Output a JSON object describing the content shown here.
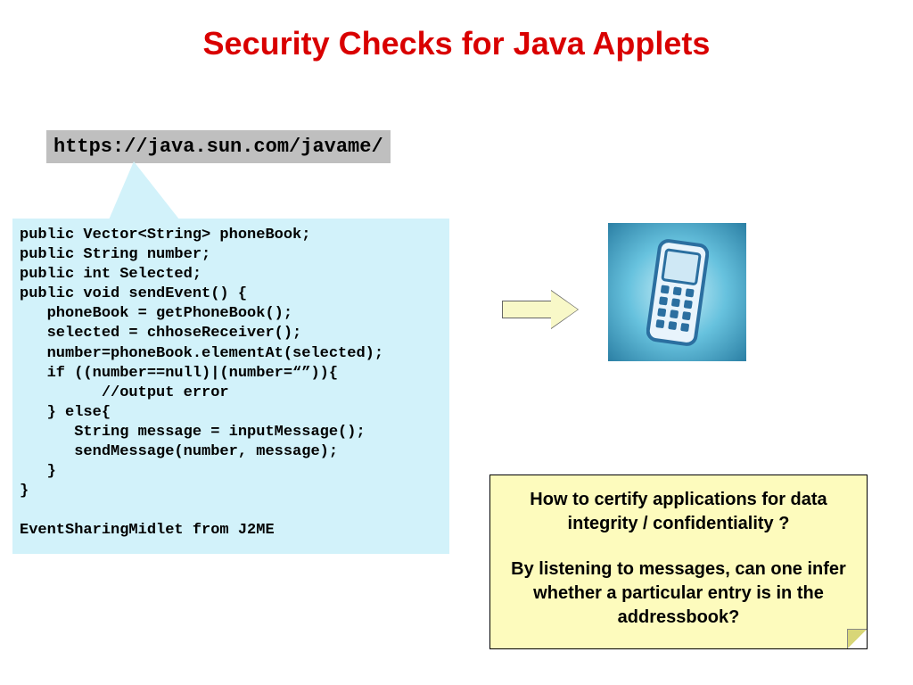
{
  "title": "Security Checks for Java Applets",
  "url": "https://java.sun.com/javame/",
  "code": "public Vector<String> phoneBook;\npublic String number;\npublic int Selected;\npublic void sendEvent() {\n   phoneBook = getPhoneBook();\n   selected = chhoseReceiver();\n   number=phoneBook.elementAt(selected);\n   if ((number==null)|(number=“”)){\n         //output error\n   } else{\n      String message = inputMessage();\n      sendMessage(number, message);\n   }\n}\n\nEventSharingMidlet from J2ME",
  "note": {
    "line1": "How to certify applications for data integrity / confidentiality ?",
    "line2": "By listening to messages, can one infer whether a particular entry is in the addressbook?"
  }
}
